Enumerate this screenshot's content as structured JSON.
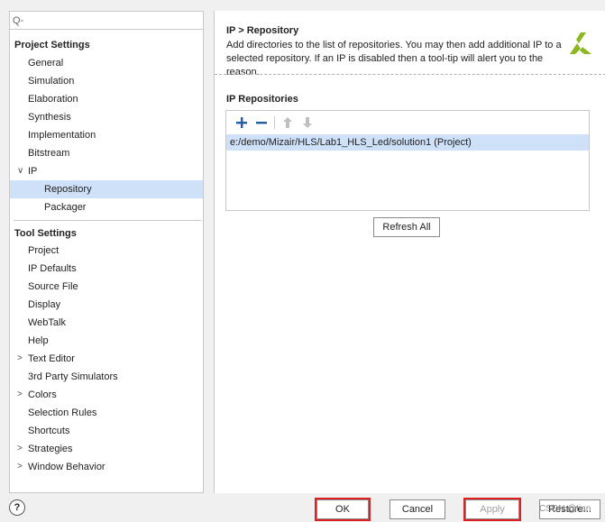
{
  "search": {
    "icon_label": "Q-",
    "placeholder": ""
  },
  "project_settings": {
    "title": "Project Settings",
    "items": [
      {
        "label": "General"
      },
      {
        "label": "Simulation"
      },
      {
        "label": "Elaboration"
      },
      {
        "label": "Synthesis"
      },
      {
        "label": "Implementation"
      },
      {
        "label": "Bitstream"
      },
      {
        "label": "IP",
        "expanded": true
      },
      {
        "label": "Repository",
        "selected": true
      },
      {
        "label": "Packager"
      }
    ]
  },
  "tool_settings": {
    "title": "Tool Settings",
    "items": [
      {
        "label": "Project"
      },
      {
        "label": "IP Defaults"
      },
      {
        "label": "Source File"
      },
      {
        "label": "Display"
      },
      {
        "label": "WebTalk"
      },
      {
        "label": "Help"
      },
      {
        "label": "Text Editor",
        "collapsed": true
      },
      {
        "label": "3rd Party Simulators"
      },
      {
        "label": "Colors",
        "collapsed": true
      },
      {
        "label": "Selection Rules"
      },
      {
        "label": "Shortcuts"
      },
      {
        "label": "Strategies",
        "collapsed": true
      },
      {
        "label": "Window Behavior",
        "collapsed": true
      }
    ]
  },
  "content": {
    "title": "IP > Repository",
    "description": "Add directories to the list of repositories. You may then add additional IP to a selected repository. If an IP is disabled then a tool-tip will alert you to the reason.",
    "repositories_title": "IP Repositories",
    "repositories": [
      "e:/demo/Mizair/HLS/Lab1_HLS_Led/solution1 (Project)"
    ],
    "refresh_label": "Refresh All"
  },
  "footer": {
    "help_label": "?",
    "ok_label": "OK",
    "cancel_label": "Cancel",
    "apply_label": "Apply",
    "restore_label": "Restore...",
    "watermark": "CSDN @tian"
  },
  "colors": {
    "selection": "#cfe1f8",
    "highlight_box": "#e02020",
    "logo": "#8cb820"
  }
}
